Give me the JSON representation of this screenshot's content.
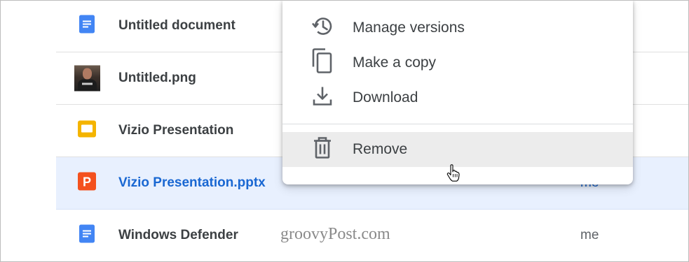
{
  "files": [
    {
      "name": "Untitled document",
      "owner": "",
      "icon": "google-docs-icon",
      "color": "#4285f4"
    },
    {
      "name": "Untitled.png",
      "owner": "",
      "icon": "image-thumbnail",
      "color": ""
    },
    {
      "name": "Vizio Presentation",
      "owner": "",
      "icon": "google-slides-icon",
      "color": "#f4b400"
    },
    {
      "name": "Vizio Presentation.pptx",
      "owner": "me",
      "icon": "powerpoint-icon",
      "color": "#f4511e",
      "selected": true
    },
    {
      "name": "Windows Defender",
      "owner": "me",
      "icon": "google-docs-icon",
      "color": "#4285f4"
    }
  ],
  "context_menu": {
    "items": [
      {
        "label": "Manage versions",
        "icon": "history-icon"
      },
      {
        "label": "Make a copy",
        "icon": "copy-icon"
      },
      {
        "label": "Download",
        "icon": "download-icon"
      },
      {
        "label": "Remove",
        "icon": "trash-icon",
        "hovered": true
      }
    ]
  },
  "colors": {
    "selected_row_bg": "#e8f0fe",
    "selected_text": "#1967d2",
    "hover_bg": "#ececec",
    "icon_gray": "#5f6368"
  },
  "watermark": "groovyPost.com"
}
